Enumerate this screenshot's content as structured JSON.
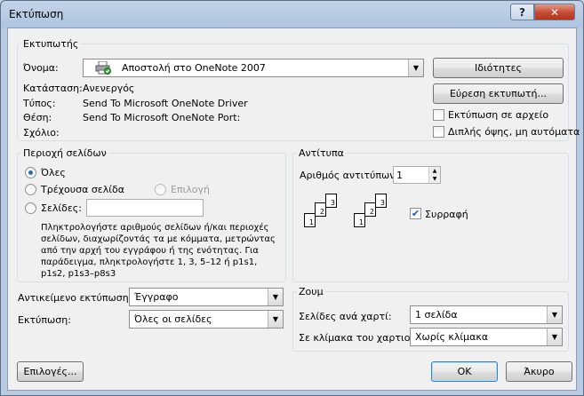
{
  "window": {
    "title": "Εκτύπωση",
    "help_glyph": "?",
    "close_glyph": "✕"
  },
  "printer": {
    "group_label": "Εκτυπωτής",
    "name_label": "Όνομα:",
    "name_value": "Αποστολή στο OneNote 2007",
    "status_label": "Κατάσταση:",
    "status_value": "Ανενεργός",
    "type_label": "Τύπος:",
    "type_value": "Send To Microsoft OneNote Driver",
    "where_label": "Θέση:",
    "where_value": "Send To Microsoft OneNote Port:",
    "comment_label": "Σχόλιο:",
    "properties_button": "Ιδιότητες",
    "find_printer_button": "Εύρεση εκτυπωτή...",
    "print_to_file_label": "Εκτύπωση σε αρχείο",
    "print_to_file_checked": false,
    "duplex_label": "Διπλής όψης, μη αυτόματα",
    "duplex_checked": false
  },
  "page_range": {
    "group_label": "Περιοχή σελίδων",
    "all_label": "Όλες",
    "current_label": "Τρέχουσα σελίδα",
    "selection_label": "Επιλογή",
    "pages_label": "Σελίδες:",
    "pages_value": "",
    "selected": "all",
    "hint": "Πληκτρολογήστε αριθμούς σελίδων ή/και περιοχές σελίδων, διαχωρίζοντάς τα με κόμματα, μετρώντας από την αρχή του εγγράφου ή της ενότητας. Για παράδειγμα, πληκτρολογήστε 1, 3, 5–12 ή p1s1, p1s2, p1s3–p8s3"
  },
  "copies": {
    "group_label": "Αντίτυπα",
    "count_label": "Αριθμός αντιτύπων:",
    "count_value": "1",
    "collate_label": "Συρραφή",
    "collate_checked": true,
    "page_numbers": [
      "1",
      "2",
      "3"
    ]
  },
  "print_what": {
    "label": "Αντικείμενο εκτύπωσης:",
    "value": "Έγγραφο"
  },
  "print": {
    "label": "Εκτύπωση:",
    "value": "Όλες οι σελίδες"
  },
  "zoom": {
    "group_label": "Ζουμ",
    "pages_per_sheet_label": "Σελίδες ανά χαρτί:",
    "pages_per_sheet_value": "1 σελίδα",
    "scale_label": "Σε κλίμακα του χαρτιού:",
    "scale_value": "Χωρίς κλίμακα"
  },
  "footer": {
    "options_button": "Επιλογές...",
    "ok_button": "OK",
    "cancel_button": "Άκυρο"
  },
  "icons": {
    "printer": "printer-icon",
    "dropdown": "chevron-down-icon",
    "spin_up": "▲",
    "spin_down": "▼",
    "checkmark": "✔"
  }
}
